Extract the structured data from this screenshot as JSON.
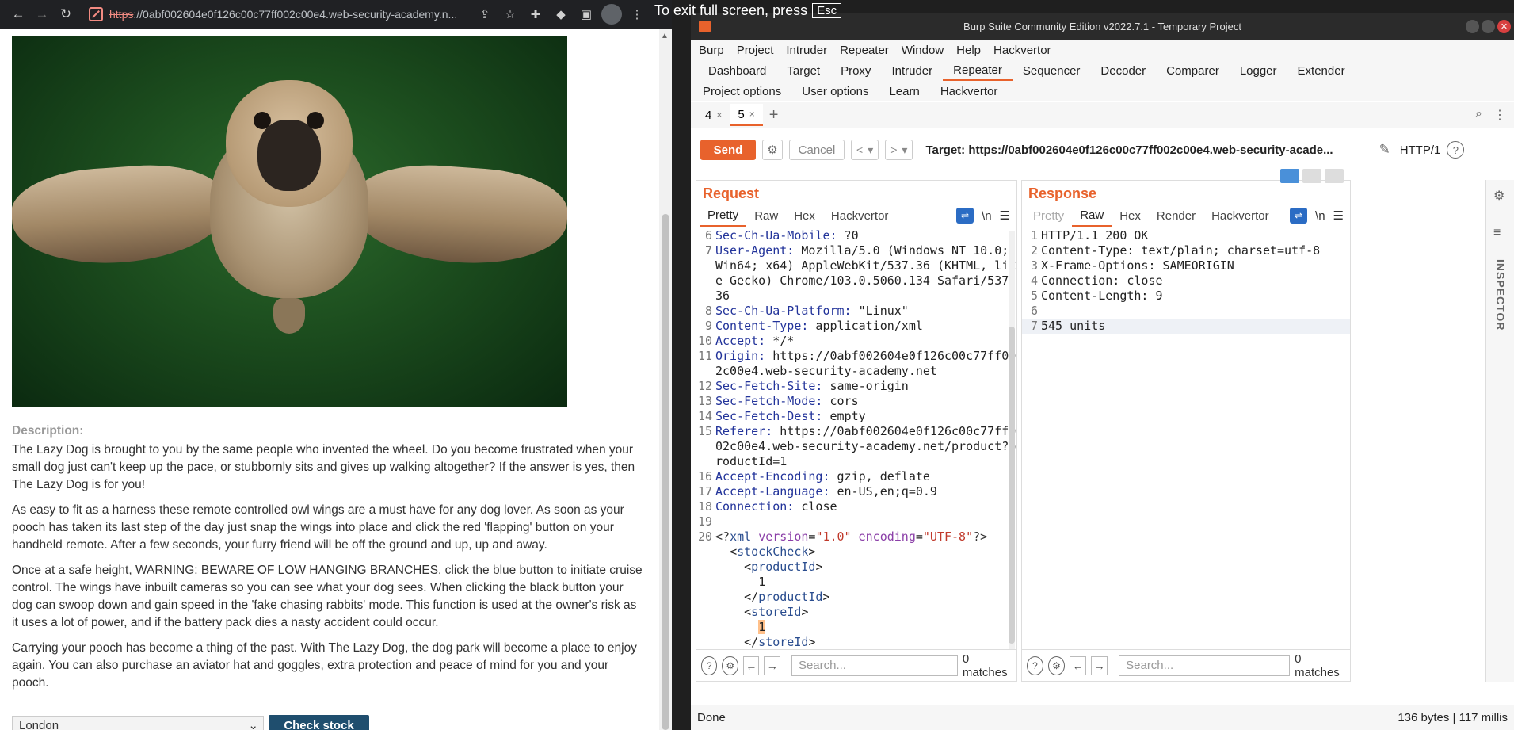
{
  "browser": {
    "url_scheme": "https",
    "url_rest": "://0abf002604e0f126c00c77ff002c00e4.web-security-academy.n...",
    "fullscreen_notice": "To exit full screen, press",
    "esc_key": "Esc",
    "description_label": "Description:",
    "paragraphs": [
      "The Lazy Dog is brought to you by the same people who invented the wheel. Do you become frustrated when your small dog just can't keep up the pace, or stubbornly sits and gives up walking altogether? If the answer is yes, then The Lazy Dog is for you!",
      "As easy to fit as a harness these remote controlled owl wings are a must have for any dog lover. As soon as your pooch has taken its last step of the day just snap the wings into place and click the red 'flapping' button on your handheld remote. After a few seconds, your furry friend will be off the ground and up, up and away.",
      "Once at a safe height, WARNING: BEWARE OF LOW HANGING BRANCHES, click the blue button to initiate cruise control. The wings have inbuilt cameras so you can see what your dog sees. When clicking the black button your dog can swoop down and gain speed in the 'fake chasing rabbits' mode. This function is used at the owner's risk as it uses a lot of power, and if the battery pack dies a nasty accident could occur.",
      "Carrying your pooch has become a thing of the past. With The Lazy Dog, the dog park will become a place to enjoy again. You can also purchase an aviator hat and goggles, extra protection and peace of mind for you and your pooch."
    ],
    "store_selected": "London",
    "check_stock_label": "Check stock"
  },
  "burp": {
    "title": "Burp Suite Community Edition v2022.7.1 - Temporary Project",
    "menu": [
      "Burp",
      "Project",
      "Intruder",
      "Repeater",
      "Window",
      "Help",
      "Hackvertor"
    ],
    "tabs_row1": [
      "Dashboard",
      "Target",
      "Proxy",
      "Intruder",
      "Repeater",
      "Sequencer",
      "Decoder",
      "Comparer",
      "Logger",
      "Extender"
    ],
    "tabs_row2": [
      "Project options",
      "User options",
      "Learn",
      "Hackvertor"
    ],
    "active_tab": "Repeater",
    "repeater_tabs": [
      {
        "label": "4"
      },
      {
        "label": "5"
      }
    ],
    "send_label": "Send",
    "cancel_label": "Cancel",
    "target_label": "Target: https://0abf002604e0f126c00c77ff002c00e4.web-security-acade...",
    "http_version": "HTTP/1",
    "request": {
      "title": "Request",
      "tabs": [
        "Pretty",
        "Raw",
        "Hex",
        "Hackvertor"
      ],
      "active_tab": "Pretty",
      "newline_toggle": "\\n",
      "search_placeholder": "Search...",
      "matches": "0 matches"
    },
    "response": {
      "title": "Response",
      "tabs": [
        "Pretty",
        "Raw",
        "Hex",
        "Render",
        "Hackvertor"
      ],
      "active_tab": "Raw",
      "newline_toggle": "\\n",
      "lines": [
        {
          "n": "1",
          "text": "HTTP/1.1 200 OK"
        },
        {
          "n": "2",
          "text": "Content-Type: text/plain; charset=utf-8"
        },
        {
          "n": "3",
          "text": "X-Frame-Options: SAMEORIGIN"
        },
        {
          "n": "4",
          "text": "Connection: close"
        },
        {
          "n": "5",
          "text": "Content-Length: 9"
        },
        {
          "n": "6",
          "text": ""
        },
        {
          "n": "7",
          "text": "545 units"
        }
      ],
      "search_placeholder": "Search...",
      "matches": "0 matches"
    },
    "inspector_label": "INSPECTOR",
    "status_left": "Done",
    "status_right": "136 bytes | 117 millis"
  }
}
